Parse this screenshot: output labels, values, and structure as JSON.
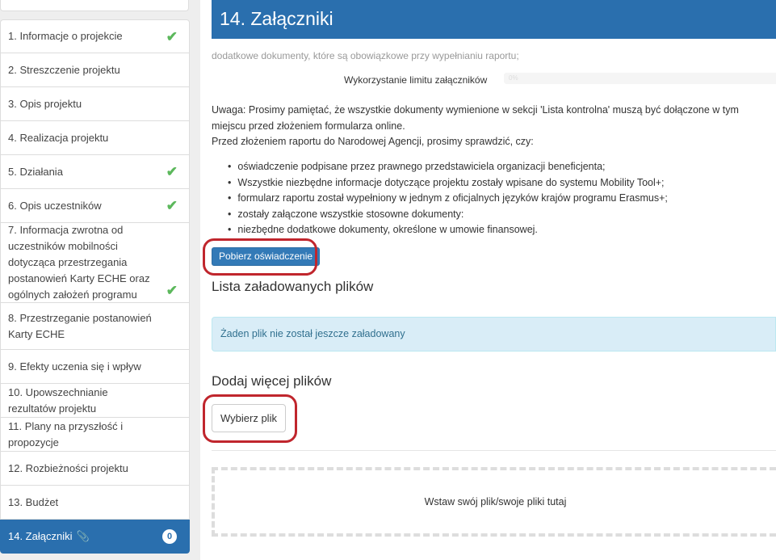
{
  "sidebar": {
    "items": [
      {
        "label": "1. Informacje o projekcie",
        "done": true
      },
      {
        "label": "2. Streszczenie projektu",
        "done": false
      },
      {
        "label": "3. Opis projektu",
        "done": false
      },
      {
        "label": "4. Realizacja projektu",
        "done": false
      },
      {
        "label": "5. Działania",
        "done": true
      },
      {
        "label": "6. Opis uczestników",
        "done": true
      },
      {
        "label": "7. Informacja zwrotna od uczestników mobilności dotycząca przestrzegania postanowień Karty ECHE oraz ogólnych założeń programu",
        "done": true
      },
      {
        "label": "8. Przestrzeganie postanowień Karty ECHE",
        "done": false
      },
      {
        "label": "9. Efekty uczenia się i wpływ",
        "done": false
      },
      {
        "label": "10. Upowszechnianie rezultatów projektu",
        "done": false
      },
      {
        "label": "11. Plany na przyszłość i propozycje",
        "done": false
      },
      {
        "label": "12. Rozbieżności projektu",
        "done": false
      },
      {
        "label": "13. Budżet",
        "done": false
      },
      {
        "label": "14. Załączniki",
        "done": false,
        "active": true,
        "badge": "0",
        "icon": "paperclip-icon"
      }
    ],
    "check_glyph": "✔",
    "clip_glyph": "📎"
  },
  "main": {
    "title": "14. Załączniki",
    "subtitle": "dodatkowe dokumenty, które są obowiązkowe przy wypełnianiu raportu;",
    "limit_label": "Wykorzystanie limitu załączników",
    "limit_value": "0%",
    "notice_line1": "Uwaga: Prosimy pamiętać, że wszystkie dokumenty wymienione w sekcji 'Lista kontrolna' muszą być dołączone w tym miejscu przed złożeniem formularza online.",
    "notice_line2": "Przed złożeniem raportu do Narodowej Agencji, prosimy sprawdzić, czy:",
    "bullets": [
      "oświadczenie podpisane przez prawnego przedstawiciela organizacji beneficjenta;",
      "Wszystkie niezbędne informacje dotyczące projektu zostały wpisane do systemu Mobility Tool+;",
      "formularz raportu został wypełniony w jednym z oficjalnych języków krajów programu Erasmus+;",
      "zostały załączone wszystkie stosowne dokumenty:",
      "niezbędne dodatkowe dokumenty, określone w umowie finansowej."
    ],
    "download_button": "Pobierz oświadczenie",
    "uploaded_heading": "Lista załadowanych plików",
    "no_files": "Żaden plik nie został jeszcze załadowany",
    "add_heading": "Dodaj więcej plików",
    "choose_button": "Wybierz plik",
    "dropzone_text": "Wstaw swój plik/swoje pliki tutaj"
  },
  "colors": {
    "accent": "#2a6fae",
    "check": "#5cb85c",
    "highlight": "#c0262d",
    "info_bg": "#d9edf7"
  }
}
